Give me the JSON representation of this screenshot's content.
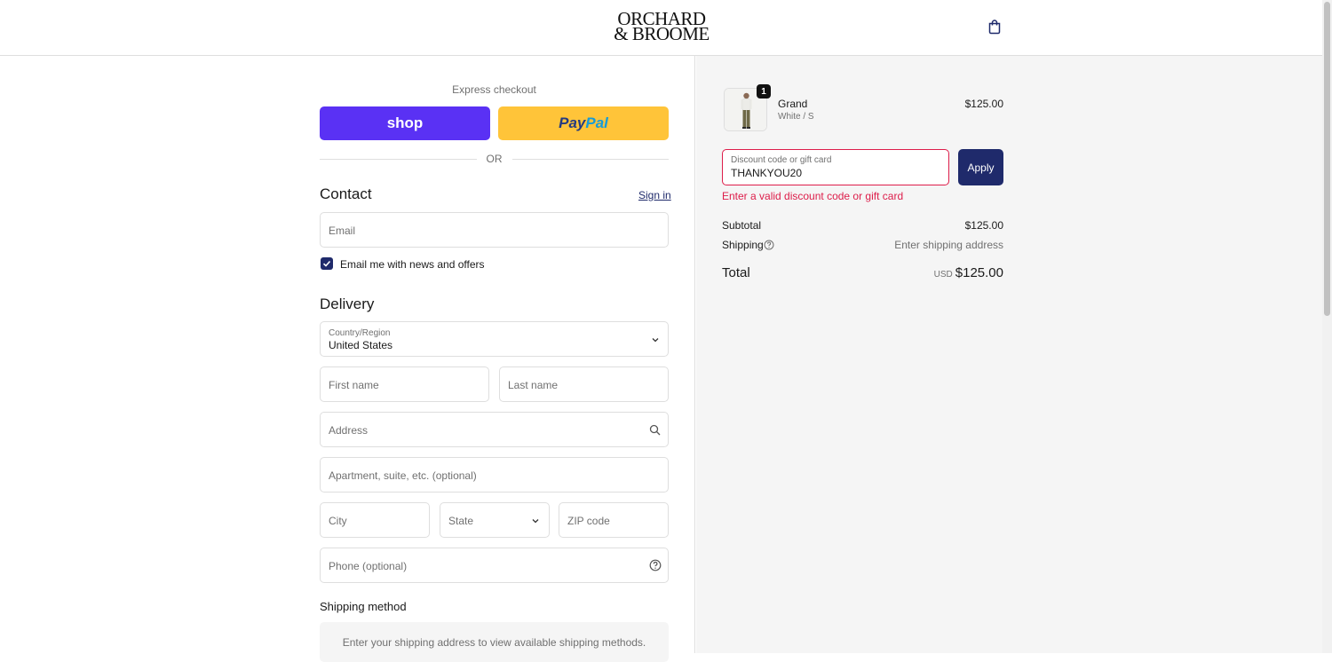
{
  "header": {
    "logo_line1": "ORCHARD",
    "logo_line2": "& BROOME",
    "cart_icon": "shopping-bag-icon"
  },
  "express": {
    "label": "Express checkout",
    "shop_label": "shop",
    "paypal_label_1": "Pay",
    "paypal_label_2": "Pal",
    "or_label": "OR"
  },
  "contact": {
    "heading": "Contact",
    "sign_in": "Sign in",
    "email_placeholder": "Email",
    "newsletter_label": "Email me with news and offers",
    "newsletter_checked": true
  },
  "delivery": {
    "heading": "Delivery",
    "country_label": "Country/Region",
    "country_value": "United States",
    "first_name_placeholder": "First name",
    "last_name_placeholder": "Last name",
    "address_placeholder": "Address",
    "apartment_placeholder": "Apartment, suite, etc. (optional)",
    "city_placeholder": "City",
    "state_placeholder": "State",
    "zip_placeholder": "ZIP code",
    "phone_placeholder": "Phone (optional)"
  },
  "shipping_method": {
    "heading": "Shipping method",
    "message": "Enter your shipping address to view available shipping methods."
  },
  "summary": {
    "product": {
      "name": "Grand",
      "variant": "White / S",
      "price": "$125.00",
      "quantity": "1"
    },
    "discount": {
      "label": "Discount code or gift card",
      "value": "THANKYOU20",
      "apply_label": "Apply",
      "error": "Enter a valid discount code or gift card"
    },
    "subtotal_label": "Subtotal",
    "subtotal_value": "$125.00",
    "shipping_label": "Shipping",
    "shipping_value": "Enter shipping address",
    "total_label": "Total",
    "currency": "USD",
    "total_value": "$125.00"
  },
  "colors": {
    "accent": "#1f2a6b",
    "shop_purple": "#5a31f4",
    "paypal_yellow": "#ffc439",
    "error": "#dd1d4a"
  }
}
